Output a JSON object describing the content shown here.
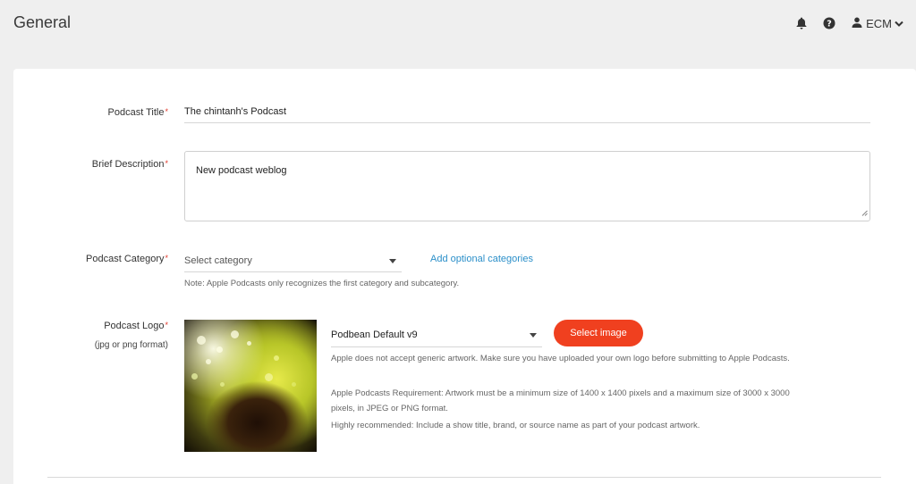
{
  "header": {
    "title": "General",
    "user_label": "ECM",
    "icons": [
      "bell-icon",
      "help-icon",
      "user-icon",
      "chevron-down-icon"
    ]
  },
  "form": {
    "podcast_title": {
      "label": "Podcast Title",
      "required_mark": "*",
      "value": "The chintanh's Podcast"
    },
    "brief_description": {
      "label": "Brief Description",
      "required_mark": "*",
      "value": "New podcast weblog"
    },
    "podcast_category": {
      "label": "Podcast Category",
      "required_mark": "*",
      "selected": "Select category",
      "optional_link": "Add optional categories",
      "note": "Note: Apple Podcasts only recognizes the first category and subcategory."
    },
    "podcast_logo": {
      "label": "Podcast Logo",
      "required_mark": "*",
      "sublabel": "(jpg or png format)",
      "selected_artwork": "Podbean Default v9",
      "select_button": "Select image",
      "note_1": "Apple does not accept generic artwork. Make sure you have uploaded your own logo before submitting to Apple Podcasts.",
      "note_2": "Apple Podcasts Requirement: Artwork must be a minimum size of 1400 x 1400 pixels and a maximum size of 3000 x 3000 pixels, in JPEG or PNG format.",
      "note_3": "Highly recommended: Include a show title, brand, or source name as part of your podcast artwork."
    }
  },
  "colors": {
    "accent": "#f0401f",
    "link": "#2b8fc9",
    "required": "#e0382a",
    "background": "#efefef"
  }
}
